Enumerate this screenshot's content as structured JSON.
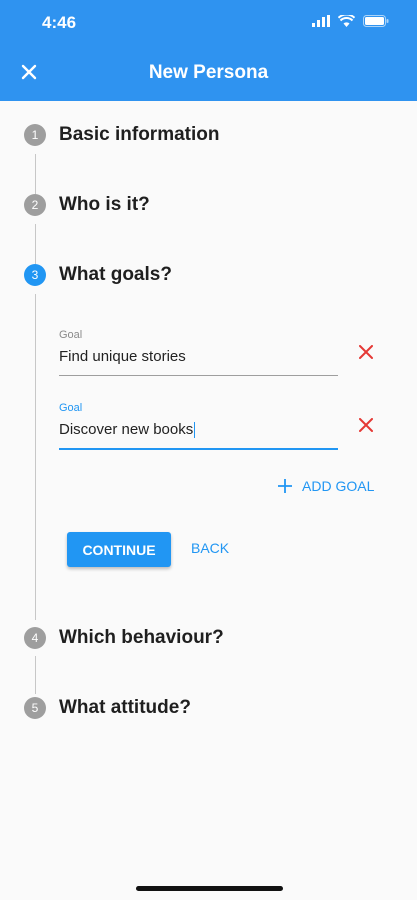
{
  "status_bar": {
    "time": "4:46"
  },
  "appbar": {
    "title": "New Persona"
  },
  "steps": [
    {
      "number": "1",
      "title": "Basic information"
    },
    {
      "number": "2",
      "title": "Who is it?"
    },
    {
      "number": "3",
      "title": "What goals?"
    },
    {
      "number": "4",
      "title": "Which behaviour?"
    },
    {
      "number": "5",
      "title": "What attitude?"
    }
  ],
  "goals": [
    {
      "label": "Goal",
      "value": "Find unique stories"
    },
    {
      "label": "Goal",
      "value": "Discover new books"
    }
  ],
  "actions": {
    "add_goal": "ADD GOAL",
    "continue": "CONTINUE",
    "back": "BACK"
  },
  "colors": {
    "primary": "#2196f3",
    "appbar": "#2f93f0",
    "remove": "#e53935",
    "inactive_step": "#9e9e9e"
  }
}
